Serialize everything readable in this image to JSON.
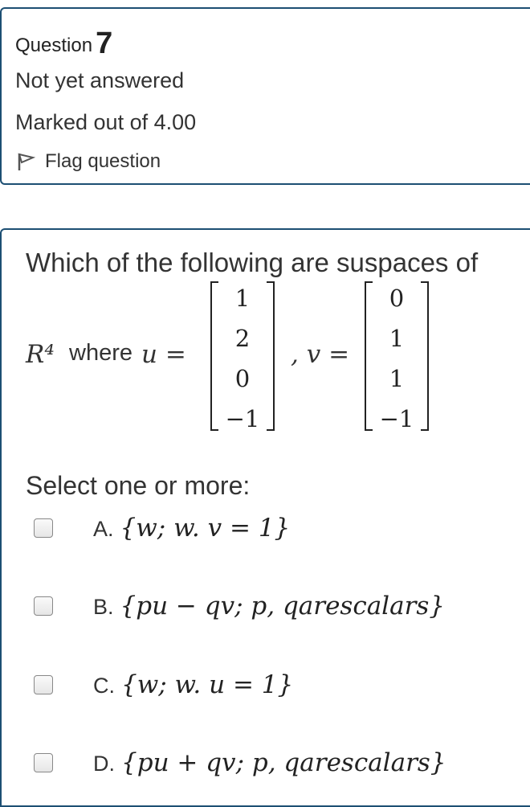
{
  "question": {
    "label": "Question",
    "number": "7",
    "state": "Not yet answered",
    "grade": "Marked out of 4.00",
    "flag_label": "Flag question"
  },
  "content": {
    "text": "Which of the following are suspaces of",
    "math_prefix": "R⁴",
    "where": "where",
    "u_eq": "u =",
    "v_eq": ", v =",
    "u_vector": [
      "1",
      "2",
      "0",
      "−1"
    ],
    "v_vector": [
      "0",
      "1",
      "1",
      "−1"
    ],
    "select_label": "Select one or more:",
    "options": [
      {
        "letter": "A.",
        "math": "{w; w. v = 1}"
      },
      {
        "letter": "B.",
        "math": "{pu − qv; p, qarescalars}"
      },
      {
        "letter": "C.",
        "math": "{w; w. u = 1}"
      },
      {
        "letter": "D.",
        "math": "{pu + qv; p, qarescalars}"
      }
    ]
  },
  "colors": {
    "border": "#1d4f73",
    "text": "#333333"
  },
  "icons": {
    "flag": "flag-icon"
  }
}
